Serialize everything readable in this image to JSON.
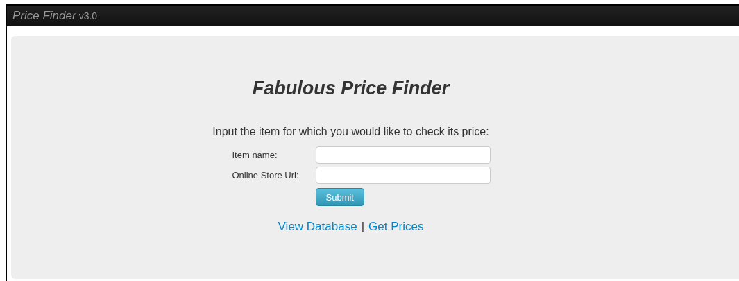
{
  "navbar": {
    "brand": "Price Finder",
    "version": "v3.0"
  },
  "hero": {
    "title": "Fabulous Price Finder",
    "prompt": "Input the item for which you would like to check its price:"
  },
  "form": {
    "fields": [
      {
        "label": "Item name:"
      },
      {
        "label": "Online Store Url:"
      }
    ],
    "submit": "Submit"
  },
  "links": {
    "items": [
      "View Database",
      "Get Prices"
    ],
    "separator": "|"
  }
}
